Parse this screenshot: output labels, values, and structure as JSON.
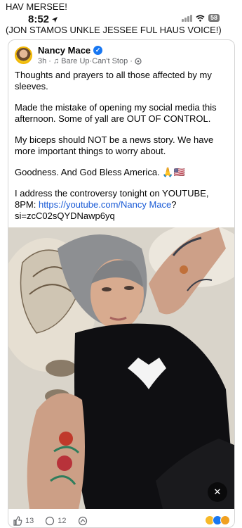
{
  "caption": {
    "line1": "HAV MERSEE!",
    "line2": "(JON STAMOS UNKLE JESSEE FUL HAUS VOICE!)"
  },
  "status_bar": {
    "time": "8:52",
    "battery": "58"
  },
  "post": {
    "author": "Nancy Mace",
    "time": "3h",
    "audio": "Bare Up·Can't Stop",
    "paragraphs": [
      "Thoughts and prayers to all those affected by my sleeves.",
      "Made the mistake of opening my social media this afternoon. Some of yall are OUT OF CONTROL.",
      "My biceps should NOT be a news story. We have more important things to worry about.",
      "Goodness. And God Bless America. 🙏🇺🇸"
    ],
    "link_intro": "I address the controversy tonight on YOUTUBE, 8PM: ",
    "link_text": "https://youtube.com/Nancy Mace",
    "link_suffix": "?si=zcC02sQYDNawp6yq",
    "likes": "13",
    "comments": "12"
  },
  "colors": {
    "link": "#1a5bd6",
    "verified": "#1877f2",
    "shirt": "#0f0f12"
  },
  "icons": [
    "location-arrow-icon",
    "signal-icon",
    "wifi-icon",
    "battery-icon",
    "verified-icon",
    "music-note-icon",
    "globe-icon",
    "mute-icon",
    "like-icon",
    "comment-icon",
    "share-icon"
  ]
}
